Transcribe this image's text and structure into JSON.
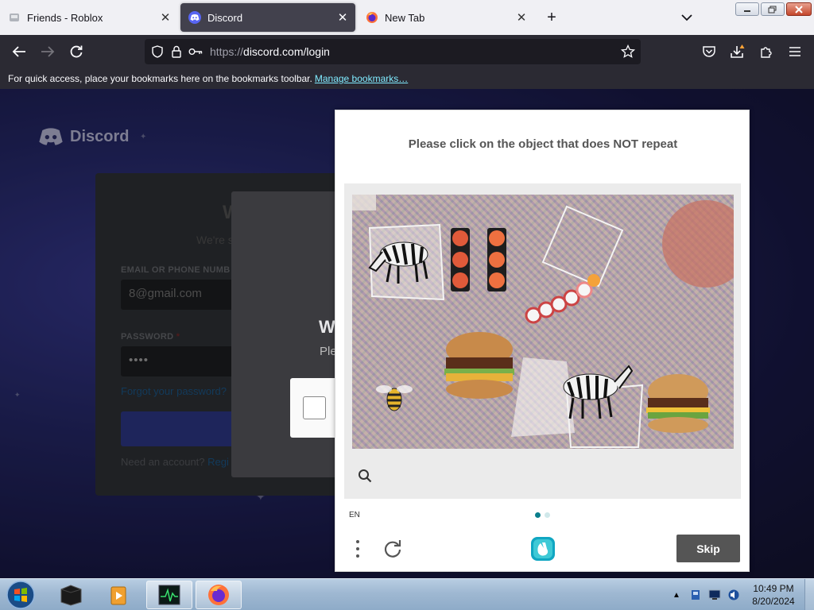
{
  "browser": {
    "tabs": [
      {
        "title": "Friends - Roblox",
        "active": false
      },
      {
        "title": "Discord",
        "active": true
      },
      {
        "title": "New Tab",
        "active": false
      }
    ],
    "url_scheme": "https://",
    "url_host_path": "discord.com/login",
    "bookmarks_hint": "For quick access, place your bookmarks here on the bookmarks toolbar.",
    "manage_bookmarks": "Manage bookmarks…"
  },
  "discord_page": {
    "logo_text": "Discord",
    "login_title_partial": "W",
    "login_subtitle_partial": "We're s",
    "email_label": "EMAIL OR PHONE NUMB",
    "email_value": "8@gmail.com",
    "password_label": "PASSWORD",
    "password_required_mark": "*",
    "password_value": "••••",
    "forgot_password": "Forgot your password?",
    "need_account_text": "Need an account?",
    "register_link": "Regi",
    "captcha_title_partial": "W",
    "captcha_sub_partial": "Ple"
  },
  "challenge": {
    "prompt": "Please click on the object that does NOT repeat",
    "language": "EN",
    "skip_label": "Skip",
    "page_dots": [
      {
        "active": true,
        "color": "#0a7e8c"
      },
      {
        "active": false,
        "color": "#d0e8ea"
      }
    ]
  },
  "taskbar": {
    "time": "10:49 PM",
    "date": "8/20/2024"
  },
  "colors": {
    "accent_teal": "#0a7e8c",
    "discord_blurple": "#5865f2",
    "skip_button": "#555555"
  }
}
